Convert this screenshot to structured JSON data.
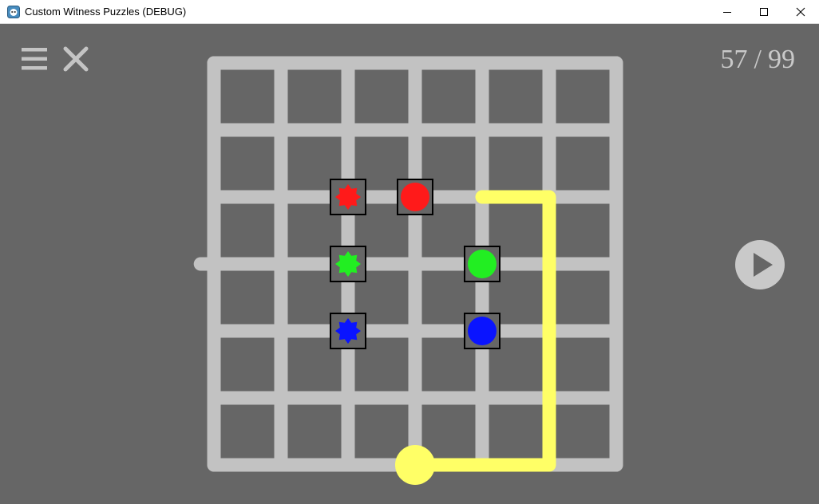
{
  "window": {
    "title": "Custom Witness Puzzles (DEBUG)",
    "minimize_icon": "minimize-icon",
    "maximize_icon": "maximize-icon",
    "close_icon": "close-icon"
  },
  "toolbar": {
    "menu_icon": "hamburger-menu-icon",
    "exit_icon": "close-x-icon"
  },
  "level": {
    "current": "57",
    "separator": "/",
    "total": "99"
  },
  "play": {
    "icon": "play-icon"
  },
  "puzzle": {
    "grid_columns": 6,
    "grid_rows": 6,
    "colors": {
      "background": "#666666",
      "grid_line": "#c2c2c2",
      "path": "#ffff66",
      "red": "#ff1a1a",
      "green": "#22ee22",
      "blue": "#0a14ff",
      "symbol_frame": "#000000"
    },
    "start_point": {
      "col": 3,
      "row": 6
    },
    "end_point": {
      "col": -0.2,
      "row": 3,
      "side": "left"
    },
    "path": [
      [
        3,
        6
      ],
      [
        5,
        6
      ],
      [
        5,
        2
      ],
      [
        4,
        2
      ]
    ],
    "symbols": [
      {
        "type": "star",
        "color": "red",
        "col": 2,
        "row": 2
      },
      {
        "type": "circle",
        "color": "red",
        "col": 3,
        "row": 2
      },
      {
        "type": "star",
        "color": "green",
        "col": 2,
        "row": 3
      },
      {
        "type": "circle",
        "color": "green",
        "col": 4,
        "row": 3
      },
      {
        "type": "star",
        "color": "blue",
        "col": 2,
        "row": 4
      },
      {
        "type": "circle",
        "color": "blue",
        "col": 4,
        "row": 4
      }
    ]
  }
}
